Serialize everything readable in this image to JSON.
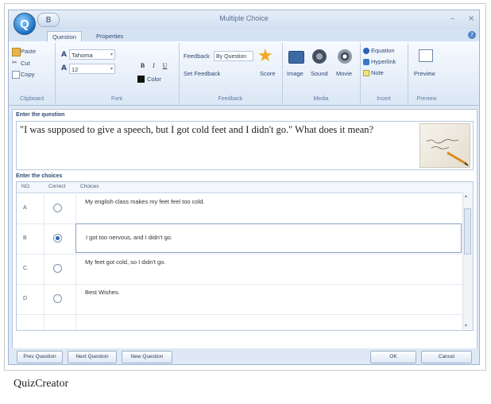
{
  "window": {
    "title": "Multiple Choice",
    "orb_letter": "Q",
    "quick_access_label": "B",
    "minimize": "–",
    "close": "×"
  },
  "tabs": [
    {
      "label": "Question",
      "active": true
    },
    {
      "label": "Properties",
      "active": false
    }
  ],
  "ribbon": {
    "clipboard": {
      "paste": "Paste",
      "cut": "Cut",
      "copy": "Copy",
      "group": "Clipboard"
    },
    "font": {
      "font_name": "Tahoma",
      "font_size": "12",
      "bold": "B",
      "italic": "I",
      "underline": "U",
      "color": "Color",
      "group": "Font"
    },
    "feedback": {
      "feedback_label": "Feedback",
      "feedback_value": "By Question",
      "set_feedback": "Set Feedback",
      "score": "Score",
      "group": "Feedback"
    },
    "media": {
      "image": "Image",
      "sound": "Sound",
      "movie": "Movie",
      "group": "Media"
    },
    "insert": {
      "equation": "Equation",
      "hyperlink": "Hyperlink",
      "note": "Note",
      "group": "Insert"
    },
    "preview": {
      "preview": "Preview",
      "group": "Preview"
    }
  },
  "question": {
    "section_label": "Enter the question",
    "text": "\"I was supposed to give a speech, but I got cold feet and I didn't go.\" What does it mean?"
  },
  "choices": {
    "section_label": "Enter the choices",
    "headers": {
      "no": "NO.",
      "correct": "Correct",
      "choices": "Choices"
    },
    "rows": [
      {
        "no": "A",
        "correct": false,
        "text": "My english class makes my feet feel too cold."
      },
      {
        "no": "B",
        "correct": true,
        "text": "I got too nervous, and I didn't go."
      },
      {
        "no": "C",
        "correct": false,
        "text": "My feet got cold, so I didn't go."
      },
      {
        "no": "D",
        "correct": false,
        "text": "Best Wishes."
      }
    ]
  },
  "footer": {
    "prev": "Prev Question",
    "next": "Next Question",
    "new": "New Question",
    "ok": "OK",
    "cancel": "Cancel"
  },
  "caption": "QuizCreator",
  "colors": {
    "accent": "#2a63b8",
    "ribbon_bg": "#dbe7f5",
    "window_bg": "#dfe9f5"
  }
}
